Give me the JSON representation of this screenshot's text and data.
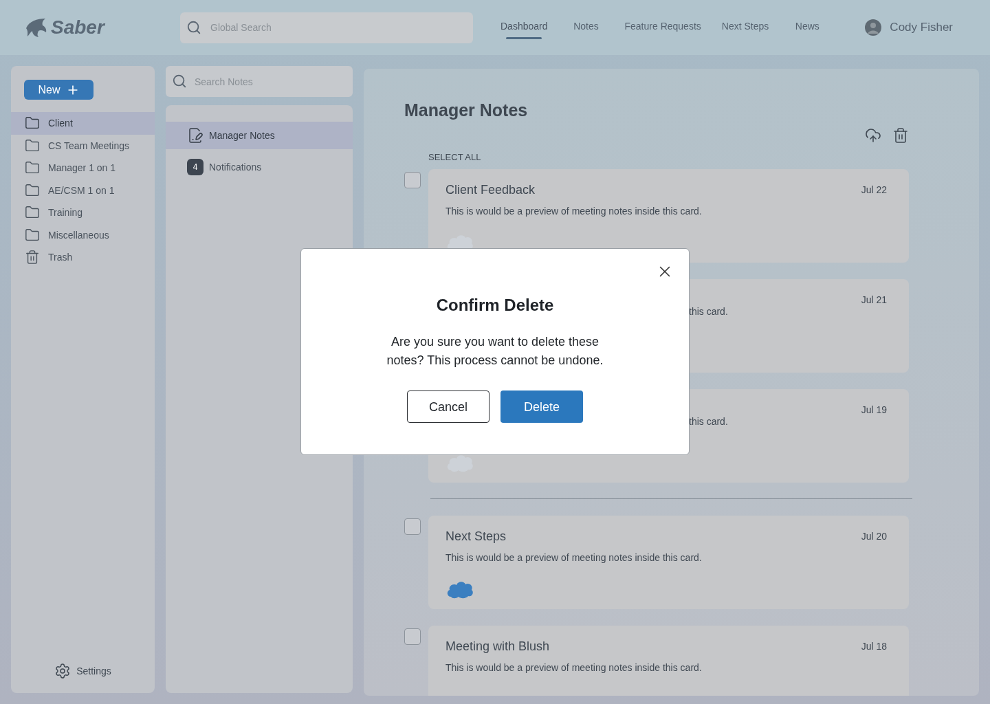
{
  "header": {
    "logo": "Saber",
    "search": {
      "placeholder": "Global Search"
    },
    "nav": [
      {
        "label": "Dashboard",
        "selected": true
      },
      {
        "label": "Notes",
        "selected": false
      },
      {
        "label": "Feature Requests",
        "selected": false
      },
      {
        "label": "Next Steps",
        "selected": false
      },
      {
        "label": "News",
        "selected": false
      }
    ],
    "user": {
      "name": "Cody Fisher"
    }
  },
  "sidebar": {
    "new_button": "New",
    "folders": [
      {
        "label": "Client",
        "kind": "folder",
        "selected": true
      },
      {
        "label": "CS Team Meetings",
        "kind": "folder",
        "selected": false
      },
      {
        "label": "Manager 1 on 1",
        "kind": "folder",
        "selected": false
      },
      {
        "label": "AE/CSM 1 on 1",
        "kind": "folder",
        "selected": false
      },
      {
        "label": "Training",
        "kind": "folder",
        "selected": false
      },
      {
        "label": "Miscellaneous",
        "kind": "folder",
        "selected": false
      },
      {
        "label": "Trash",
        "kind": "trash",
        "selected": false
      }
    ],
    "settings": "Settings"
  },
  "notes_panel": {
    "search": {
      "placeholder": "Search Notes"
    },
    "items": [
      {
        "label": "Manager Notes",
        "kind": "notes",
        "selected": true
      },
      {
        "label": "Notifications",
        "kind": "count",
        "badge": "4",
        "selected": false
      }
    ]
  },
  "main": {
    "title": "Manager Notes",
    "select_all": "SELECT ALL",
    "sections": [
      {
        "cards": [
          {
            "title": "Client Feedback",
            "preview": "This is would be a preview of meeting notes inside this card.",
            "date": "Jul 22",
            "checked": false,
            "has_logo": true,
            "logo_faded": true
          },
          {
            "preview_tail": "this card.",
            "date": "Jul 21"
          },
          {
            "preview_tail": "this card.",
            "date": "Jul 19",
            "has_logo": true,
            "logo_faded": true
          }
        ]
      },
      {
        "cards": [
          {
            "title": "Next Steps",
            "preview": "This is would be a preview of meeting notes inside this card.",
            "date": "Jul 20",
            "checked": false,
            "has_logo": true,
            "logo_faded": false
          },
          {
            "title": "Meeting with Blush",
            "preview": "This is would be a preview of meeting notes inside this card.",
            "date": "Jul 18",
            "checked": false
          }
        ]
      }
    ]
  },
  "modal": {
    "title": "Confirm Delete",
    "message": "Are you sure you want to delete these notes? This process cannot be undone.",
    "buttons": [
      {
        "label": "Cancel",
        "kind": "secondary"
      },
      {
        "label": "Delete",
        "kind": "primary"
      }
    ]
  }
}
